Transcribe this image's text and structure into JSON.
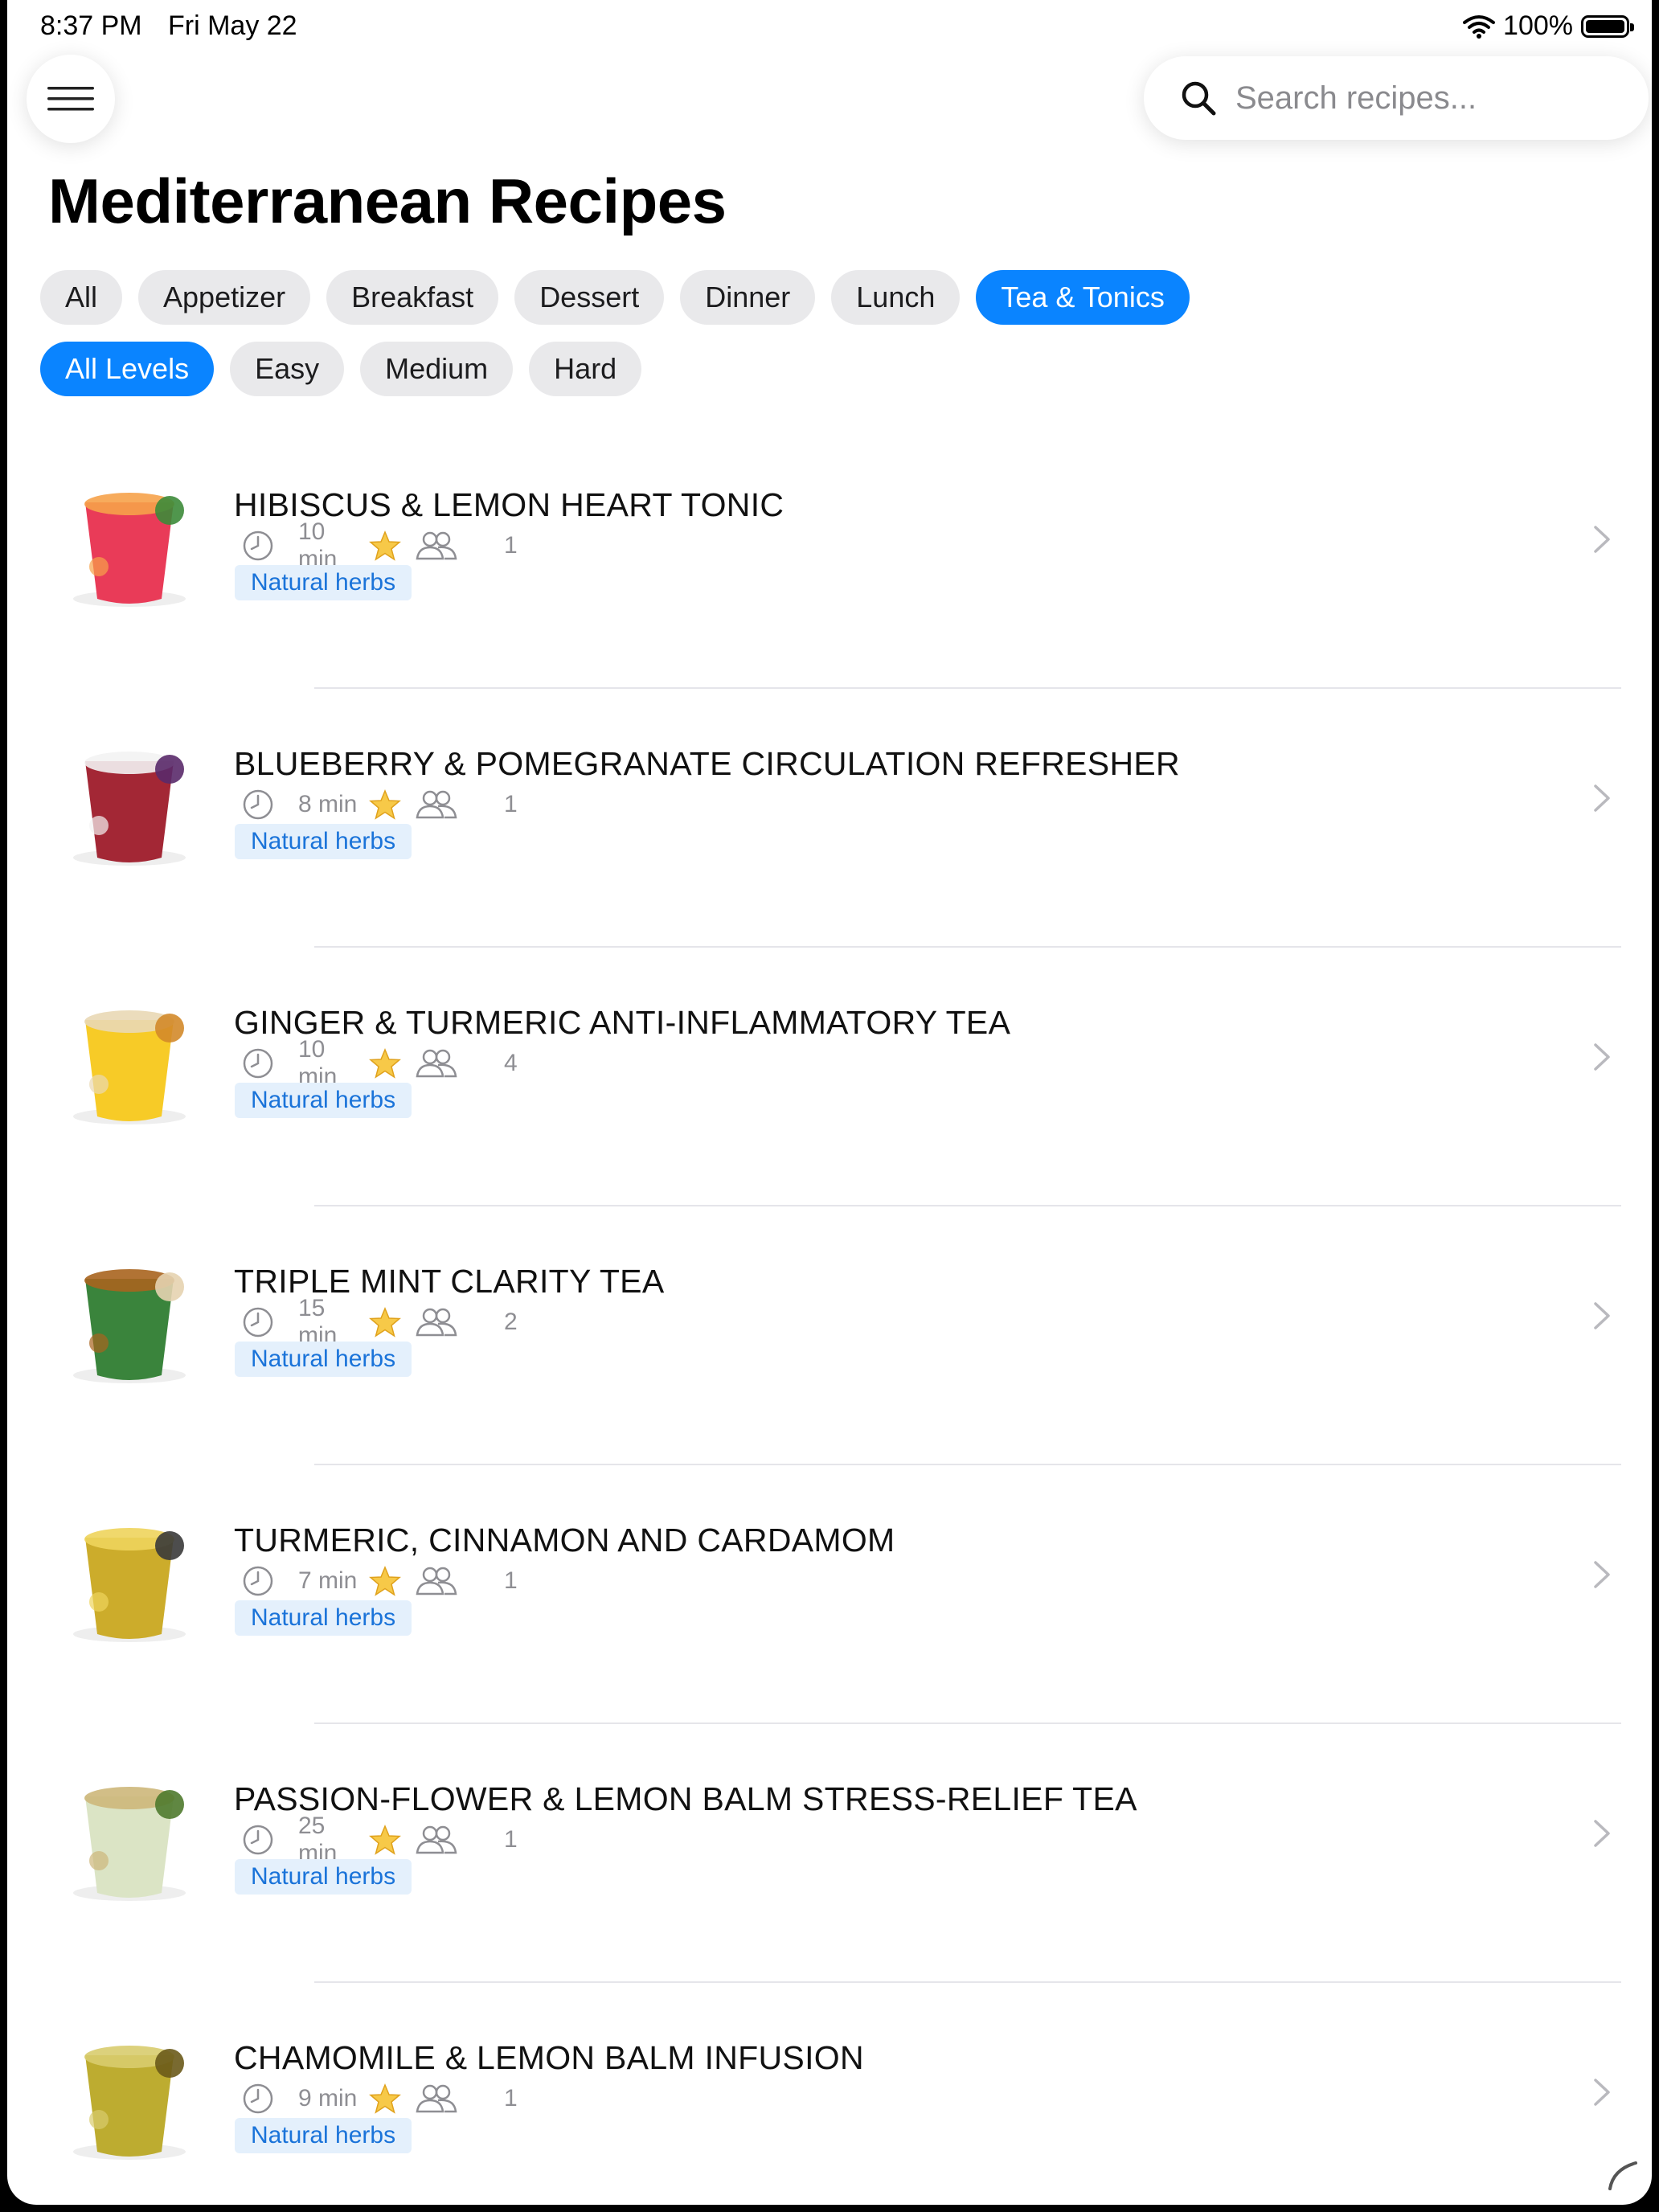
{
  "status": {
    "time": "8:37 PM",
    "date": "Fri May 22",
    "battery": "100%",
    "battery_level": 1.0
  },
  "search": {
    "placeholder": "Search recipes..."
  },
  "page_title": "Mediterranean Recipes",
  "categories": [
    {
      "label": "All",
      "active": false
    },
    {
      "label": "Appetizer",
      "active": false
    },
    {
      "label": "Breakfast",
      "active": false
    },
    {
      "label": "Dessert",
      "active": false
    },
    {
      "label": "Dinner",
      "active": false
    },
    {
      "label": "Lunch",
      "active": false
    },
    {
      "label": "Tea & Tonics",
      "active": true
    }
  ],
  "levels": [
    {
      "label": "All Levels",
      "active": true
    },
    {
      "label": "Easy",
      "active": false
    },
    {
      "label": "Medium",
      "active": false
    },
    {
      "label": "Hard",
      "active": false
    }
  ],
  "recipes": [
    {
      "title": "HIBISCUS & LEMON HEART TONIC",
      "time": "10 min",
      "servings": "1",
      "tag": "Natural herbs",
      "thumb": "hibiscus-tonic",
      "colors": [
        "#e8304f",
        "#f6a24a",
        "#3d8b3a"
      ]
    },
    {
      "title": "BLUEBERRY & POMEGRANATE CIRCULATION REFRESHER",
      "time": "8 min",
      "servings": "1",
      "tag": "Natural herbs",
      "thumb": "berry-refresher",
      "colors": [
        "#9e1b2a",
        "#f3f3f3",
        "#5a2a6a"
      ]
    },
    {
      "title": "GINGER & TURMERIC ANTI-INFLAMMATORY TEA",
      "time": "10 min",
      "servings": "4",
      "tag": "Natural herbs",
      "thumb": "ginger-turmeric-tea",
      "colors": [
        "#f7c81b",
        "#e9d8b5",
        "#d38a2a"
      ]
    },
    {
      "title": "TRIPLE MINT CLARITY TEA",
      "time": "15 min",
      "servings": "2",
      "tag": "Natural herbs",
      "thumb": "mint-tea",
      "colors": [
        "#2f7d32",
        "#a8641e",
        "#e6d3b0"
      ]
    },
    {
      "title": "TURMERIC, CINNAMON AND CARDAMOM",
      "time": "7 min",
      "servings": "1",
      "tag": "Natural herbs",
      "thumb": "turmeric-latte",
      "colors": [
        "#c9a820",
        "#eed45c",
        "#3a3a3a"
      ]
    },
    {
      "title": "PASSION-FLOWER & LEMON BALM STRESS-RELIEF TEA",
      "time": "25 min",
      "servings": "1",
      "tag": "Natural herbs",
      "thumb": "passionflower-tea",
      "colors": [
        "#d9e3c2",
        "#cdb77a",
        "#4f7a2e"
      ]
    },
    {
      "title": "CHAMOMILE & LEMON BALM INFUSION",
      "time": "9 min",
      "servings": "1",
      "tag": "Natural herbs",
      "thumb": "chamomile-infusion",
      "colors": [
        "#b9a825",
        "#d8cc6e",
        "#6a5a1a"
      ]
    }
  ]
}
